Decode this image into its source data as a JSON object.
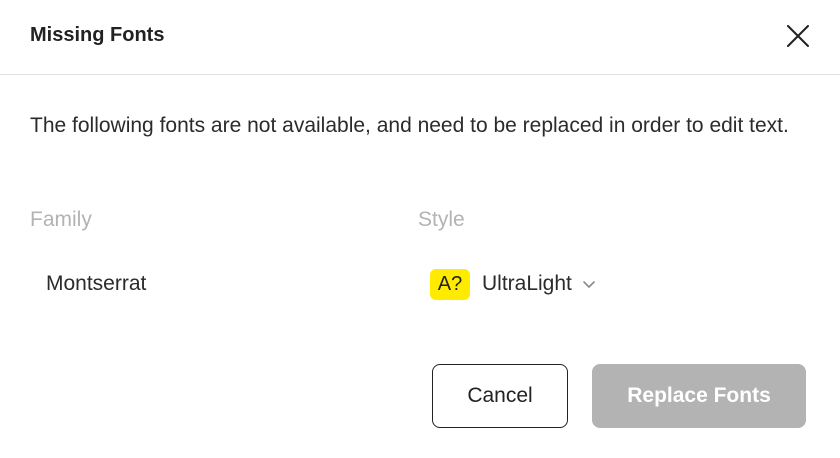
{
  "dialog": {
    "title": "Missing Fonts",
    "close_icon": "close-icon",
    "message": "The following fonts are not available, and need to be replaced in order to edit text."
  },
  "table": {
    "headers": {
      "family": "Family",
      "style": "Style"
    },
    "rows": [
      {
        "family": "Montserrat",
        "badge": "A?",
        "style": "UltraLight"
      }
    ]
  },
  "buttons": {
    "cancel": "Cancel",
    "replace": "Replace Fonts"
  },
  "colors": {
    "badge_bg": "#ffeb00",
    "disabled_button": "#b3b3b3",
    "header_text": "#b3b3b3"
  }
}
